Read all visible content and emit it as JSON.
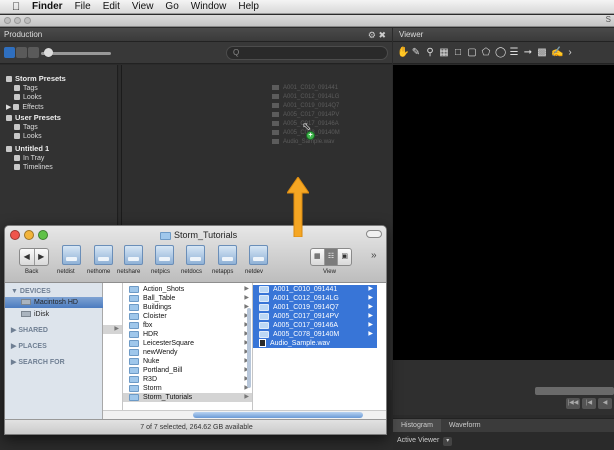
{
  "menubar": {
    "app_name": "Finder",
    "items": [
      "File",
      "Edit",
      "View",
      "Go",
      "Window",
      "Help"
    ]
  },
  "app": {
    "right_letter": "S"
  },
  "production": {
    "title": "Production",
    "search_placeholder": "Q",
    "sidebar": [
      {
        "label": "Storm Presets",
        "kind": "header"
      },
      {
        "label": "Tags",
        "kind": "item"
      },
      {
        "label": "Looks",
        "kind": "item"
      },
      {
        "label": "Effects",
        "kind": "item"
      },
      {
        "label": "User Presets",
        "kind": "header"
      },
      {
        "label": "Tags",
        "kind": "item"
      },
      {
        "label": "Looks",
        "kind": "item"
      },
      {
        "label": "Untitled 1",
        "kind": "header"
      },
      {
        "label": "In Tray",
        "kind": "item"
      },
      {
        "label": "Timelines",
        "kind": "item"
      }
    ],
    "ghost_files": [
      "A001_C010_091441",
      "A001_C012_0914LG",
      "A001_C019_0914Q7",
      "A005_C017_0914PV",
      "A005_C017_09146A",
      "A005_C078_09140M",
      "Audio_Sample.wav"
    ]
  },
  "viewer": {
    "title": "Viewer",
    "tabs": [
      "Histogram",
      "Waveform"
    ],
    "active_viewer_label": "Active Viewer",
    "transport_buttons": [
      "|◀◀",
      "|◀",
      "◀"
    ]
  },
  "finder": {
    "title": "Storm_Tutorials",
    "toolbar": {
      "back_label": "Back",
      "view_label": "View",
      "shares": [
        "netdist",
        "nethome",
        "netshare",
        "netpics",
        "netdocs",
        "netapps",
        "netdev"
      ]
    },
    "sidebar": [
      {
        "label": "DEVICES",
        "kind": "section"
      },
      {
        "label": "Macintosh HD",
        "kind": "selected"
      },
      {
        "label": "iDisk",
        "kind": "item"
      },
      {
        "label": "SHARED",
        "kind": "section"
      },
      {
        "label": "PLACES",
        "kind": "section"
      },
      {
        "label": "SEARCH FOR",
        "kind": "section"
      }
    ],
    "folders": [
      "Action_Shots",
      "Ball_Table",
      "Buildings",
      "Cloister",
      "fbx",
      "HDR",
      "LeicesterSquare",
      "newWendy",
      "Nuke",
      "Portland_Bill",
      "R3D",
      "Storm",
      "Storm_Tutorials"
    ],
    "selected_folder_index": 12,
    "files": [
      "A001_C010_091441",
      "A001_C012_0914LG",
      "A001_C019_0914Q7",
      "A005_C017_0914PV",
      "A005_C017_09146A",
      "A005_C078_09140M",
      "Audio_Sample.wav"
    ],
    "status": "7 of 7 selected, 264.62 GB available"
  },
  "colors": {
    "arrow": "#f5a623",
    "selection": "#3875d7",
    "drop_badge": "#3fb44c"
  }
}
